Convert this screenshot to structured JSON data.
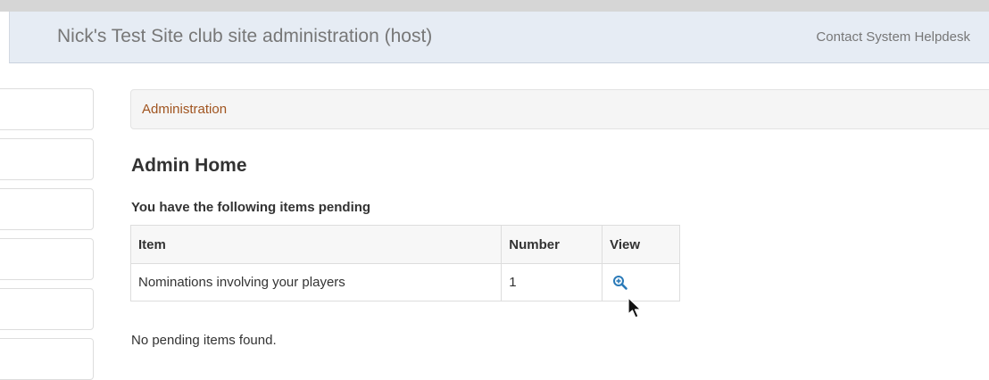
{
  "header": {
    "site_title": "Nick's Test Site club site administration (host)",
    "helpdesk_link": "Contact System Helpdesk"
  },
  "sidebar": {
    "items": [
      "",
      "",
      "",
      "",
      "",
      ""
    ]
  },
  "breadcrumb": {
    "items": [
      "Administration"
    ]
  },
  "main": {
    "title": "Admin Home",
    "pending_heading": "You have the following items pending",
    "table": {
      "columns": [
        "Item",
        "Number",
        "View"
      ],
      "rows": [
        {
          "item": "Nominations involving your players",
          "number": "1",
          "view_icon": "zoom-in-icon"
        }
      ]
    },
    "empty_message": "No pending items found."
  },
  "colors": {
    "navbar_bg": "#e6ecf4",
    "link_brown": "#a0541f",
    "icon_blue": "#2a7ab8"
  }
}
